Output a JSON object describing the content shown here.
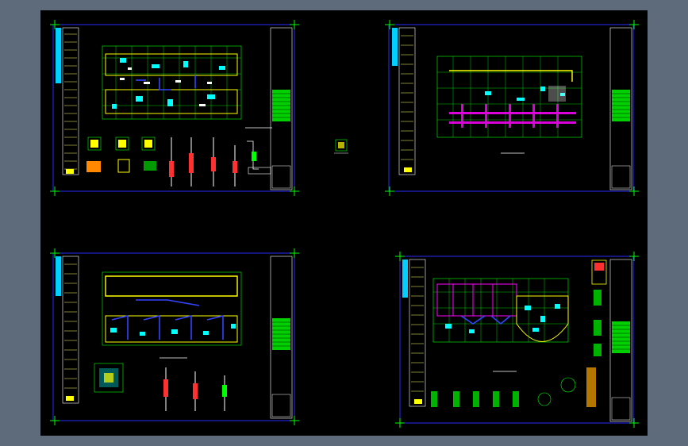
{
  "app": {
    "title": "",
    "background_color": "#5e6b7a",
    "canvas_color": "#000000"
  },
  "colors": {
    "frame": "#1a1aff",
    "grid": "#00ff00",
    "accent_yellow": "#ffff00",
    "accent_cyan": "#00ffff",
    "accent_magenta": "#ff00ff",
    "accent_red": "#ff3030",
    "white": "#ffffff",
    "crosshair": "#00ff00"
  },
  "sheets": [
    {
      "id": "sheet-1"
    },
    {
      "id": "sheet-2"
    },
    {
      "id": "sheet-3"
    },
    {
      "id": "sheet-4"
    }
  ]
}
